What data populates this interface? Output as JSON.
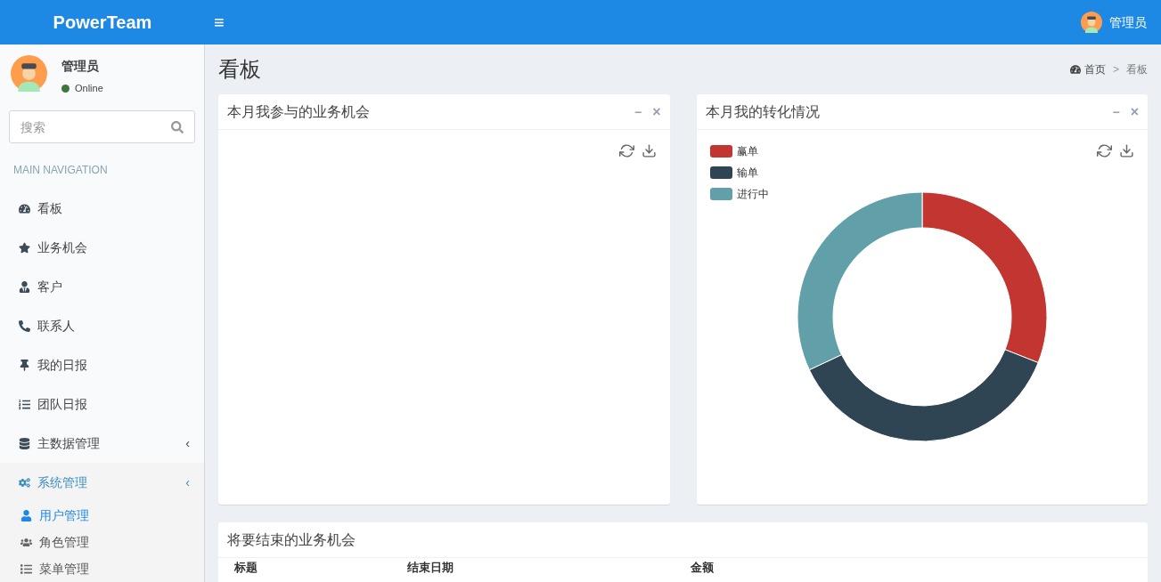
{
  "header": {
    "brand": "PowerTeam",
    "menu_toggle": "≡",
    "user_name": "管理员"
  },
  "sidebar": {
    "user": {
      "name": "管理员",
      "status": "Online",
      "online": true
    },
    "search": {
      "placeholder": "搜索"
    },
    "section_title": "MAIN NAVIGATION",
    "items": [
      {
        "label": "看板",
        "selected": false
      },
      {
        "label": "业务机会",
        "selected": false
      },
      {
        "label": "客户",
        "selected": false
      },
      {
        "label": "联系人",
        "selected": false
      },
      {
        "label": "我的日报",
        "selected": false
      },
      {
        "label": "团队日报",
        "selected": false
      },
      {
        "label": "主数据管理",
        "selected": false,
        "caret": "‹"
      },
      {
        "label": "系统管理",
        "selected": true,
        "expanded": true,
        "caret": "‹",
        "children": [
          {
            "label": "用户管理",
            "selected": true
          },
          {
            "label": "角色管理",
            "selected": false
          },
          {
            "label": "菜单管理",
            "selected": false
          }
        ]
      }
    ]
  },
  "page": {
    "title": "看板",
    "breadcrumb": [
      {
        "label": "首页"
      },
      {
        "label": "看板"
      }
    ],
    "breadcrumb_separator": ">"
  },
  "panels": [
    {
      "title": "本月我参与的业务机会",
      "minimize": "−",
      "close": "×"
    },
    {
      "title": "本月我的转化情况",
      "minimize": "−",
      "close": "×",
      "legend": [
        {
          "label": "赢单",
          "color": "#c23531"
        },
        {
          "label": "输单",
          "color": "#2f4554"
        },
        {
          "label": "进行中",
          "color": "#61a0a8"
        }
      ]
    }
  ],
  "table_panel": {
    "title": "将要结束的业务机会",
    "columns": [
      "标题",
      "结束日期",
      "金额"
    ]
  }
}
